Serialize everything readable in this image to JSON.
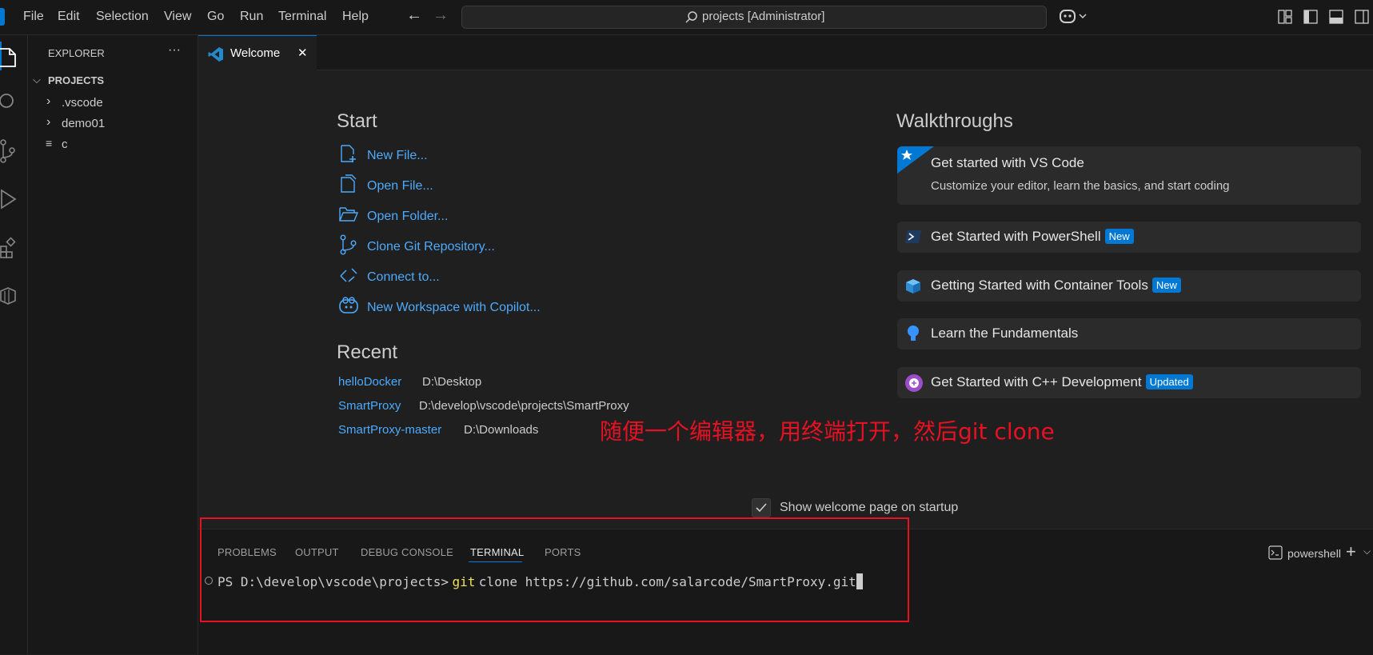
{
  "menu": [
    "File",
    "Edit",
    "Selection",
    "View",
    "Go",
    "Run",
    "Terminal",
    "Help"
  ],
  "search": {
    "text": "projects [Administrator]"
  },
  "sidebar": {
    "title": "EXPLORER",
    "more": "···",
    "section": "PROJECTS",
    "items": [
      ".vscode",
      "demo01",
      "c"
    ]
  },
  "tab": {
    "label": "Welcome",
    "close": "✕"
  },
  "welcome": {
    "start_heading": "Start",
    "start_items": [
      "New File...",
      "Open File...",
      "Open Folder...",
      "Clone Git Repository...",
      "Connect to...",
      "New Workspace with Copilot..."
    ],
    "recent_heading": "Recent",
    "recent": [
      {
        "name": "helloDocker",
        "path": "D:\\Desktop"
      },
      {
        "name": "SmartProxy",
        "path": "D:\\develop\\vscode\\projects\\SmartProxy"
      },
      {
        "name": "SmartProxy-master",
        "path": "D:\\Downloads"
      }
    ],
    "walkthroughs_heading": "Walkthroughs",
    "walkthroughs": [
      {
        "title": "Get started with VS Code",
        "desc": "Customize your editor, learn the basics, and start coding"
      },
      {
        "title": "Get Started with PowerShell",
        "badge": "New"
      },
      {
        "title": "Getting Started with Container Tools",
        "badge": "New"
      },
      {
        "title": "Learn the Fundamentals"
      },
      {
        "title": "Get Started with C++ Development",
        "badge": "Updated"
      }
    ],
    "show_on_startup": "Show welcome page on startup"
  },
  "annotation": "随便一个编辑器，用终端打开，然后git clone",
  "panel": {
    "tabs": [
      "PROBLEMS",
      "OUTPUT",
      "DEBUG CONSOLE",
      "TERMINAL",
      "PORTS"
    ],
    "shell": "powershell",
    "prompt": "PS D:\\develop\\vscode\\projects>",
    "cmd": "git",
    "args": "clone https://github.com/salarcode/SmartProxy.git"
  },
  "colors": {
    "accent": "#0078d4",
    "link": "#4daafc",
    "annotation": "#e81123",
    "bg": "#1f1f1f"
  }
}
